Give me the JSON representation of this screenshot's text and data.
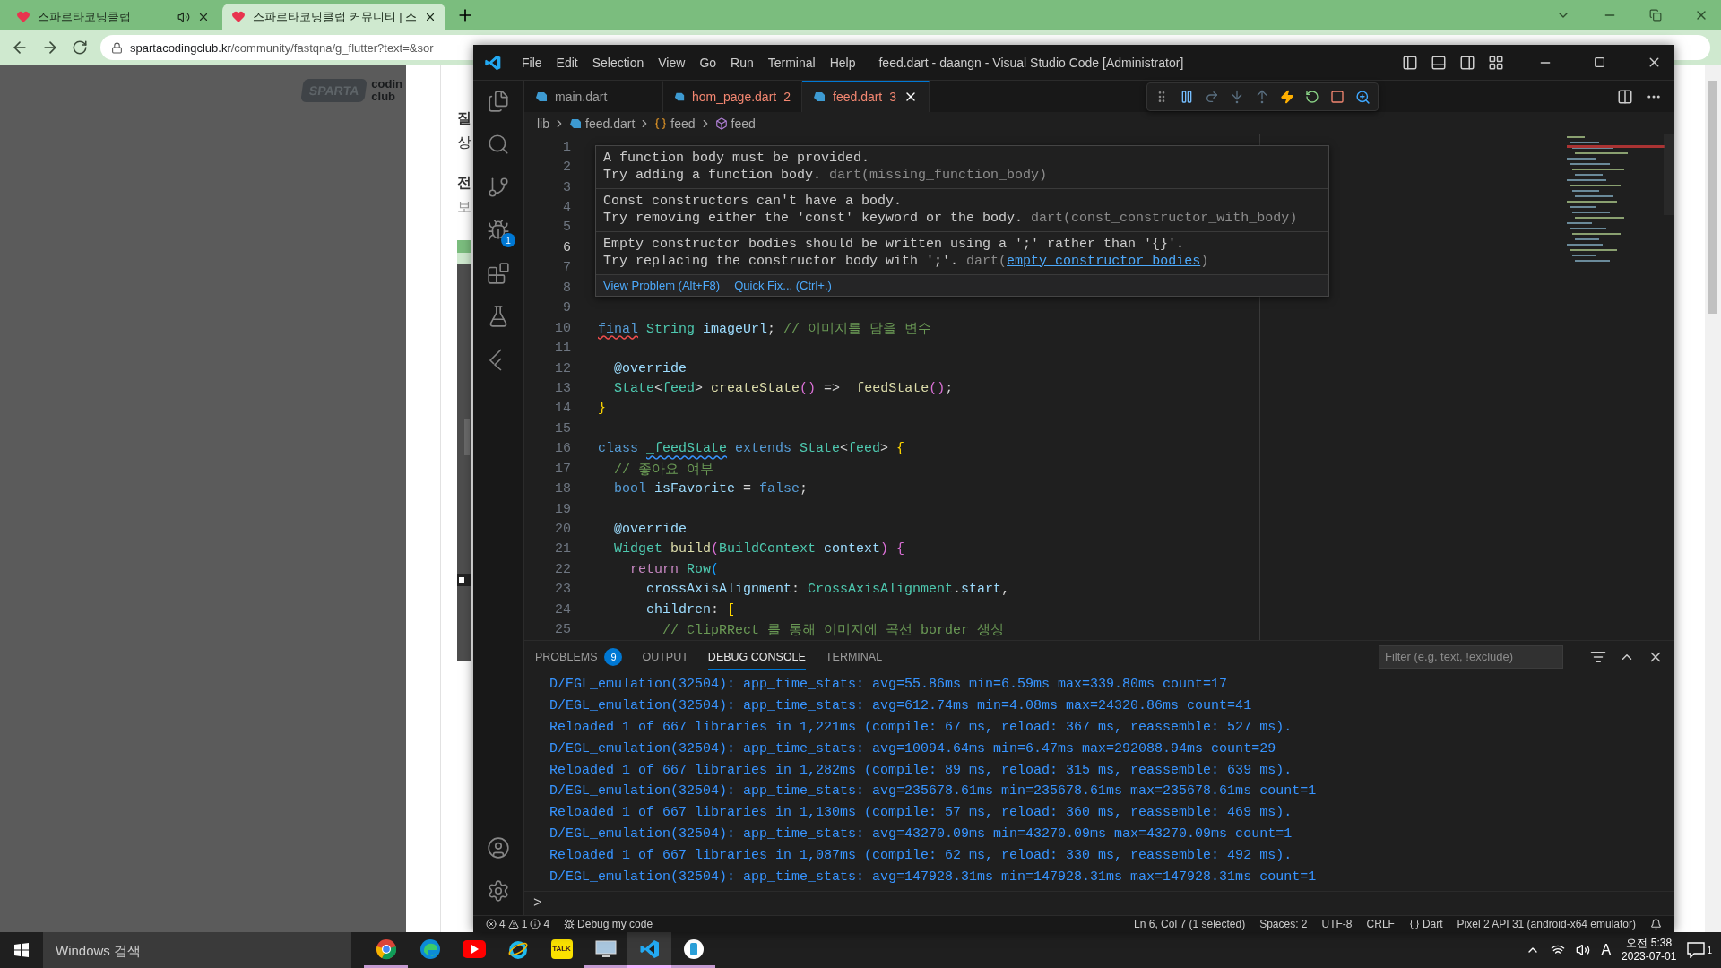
{
  "browser": {
    "tabs": [
      {
        "title": "스파르타코딩클럽",
        "selected": false,
        "audio": true
      },
      {
        "title": "스파르타코딩클럽 커뮤니티 | 스",
        "selected": true,
        "audio": false
      }
    ],
    "url": {
      "host": "spartacodingclub.kr",
      "path": "/community/fastqna/g_flutter?text=&sor"
    }
  },
  "page": {
    "logo": {
      "badge": "SPARTA",
      "words": [
        "codin",
        "club"
      ]
    },
    "texts": [
      {
        "kind": "heading",
        "text": "질"
      },
      {
        "kind": "body",
        "text": "상"
      },
      {
        "kind": "heading",
        "text": "전"
      },
      {
        "kind": "muted",
        "text": "보"
      }
    ]
  },
  "vscode": {
    "menu": [
      "File",
      "Edit",
      "Selection",
      "View",
      "Go",
      "Run",
      "Terminal",
      "Help"
    ],
    "title": "feed.dart - daangn - Visual Studio Code [Administrator]",
    "activity": [
      {
        "kind": "explorer",
        "selected": false
      },
      {
        "kind": "search",
        "selected": false
      },
      {
        "kind": "scm",
        "selected": false
      },
      {
        "kind": "debug",
        "selected": false,
        "badge": "1"
      },
      {
        "kind": "extensions",
        "selected": false
      },
      {
        "kind": "testing",
        "selected": false
      },
      {
        "kind": "flutter",
        "selected": false
      }
    ],
    "activity_bottom": [
      {
        "kind": "account"
      },
      {
        "kind": "settings"
      }
    ],
    "tabs": [
      {
        "label": "main.dart",
        "selected": false
      },
      {
        "label": "hom_page.dart",
        "selected": false,
        "problems": "2"
      },
      {
        "label": "feed.dart",
        "selected": true,
        "problems": "3"
      }
    ],
    "breadcrumbs": [
      {
        "kind": "folder",
        "label": "lib"
      },
      {
        "kind": "file",
        "label": "feed.dart"
      },
      {
        "kind": "class",
        "label": "feed"
      },
      {
        "kind": "member",
        "label": "feed"
      }
    ],
    "lines": [
      {
        "number": "1",
        "current": false
      },
      {
        "number": "2",
        "current": false
      },
      {
        "number": "3",
        "current": false
      },
      {
        "number": "4",
        "current": false
      },
      {
        "number": "5",
        "current": false
      },
      {
        "number": "6",
        "current": true
      },
      {
        "number": "7",
        "current": false
      },
      {
        "number": "8",
        "current": false
      },
      {
        "number": "9",
        "current": false
      },
      {
        "number": "10",
        "current": false,
        "tokens": [
          {
            "kind": "kw",
            "t": "final",
            "error_squiggle": true
          },
          {
            "kind": "type",
            "t": " String"
          },
          {
            "kind": "var",
            "t": " imageUrl"
          },
          {
            "kind": "plain",
            "t": ";"
          },
          {
            "kind": "comment",
            "t": " // 이미지를 담을 변수"
          }
        ]
      },
      {
        "number": "11",
        "current": false
      },
      {
        "number": "12",
        "current": false,
        "tokens": [
          {
            "kind": "anno",
            "t": "  @override"
          }
        ]
      },
      {
        "number": "13",
        "current": false,
        "tokens": [
          {
            "kind": "type",
            "t": "  State"
          },
          {
            "kind": "plain",
            "t": "<"
          },
          {
            "kind": "type",
            "t": "feed"
          },
          {
            "kind": "plain",
            "t": ">"
          },
          {
            "kind": "fn",
            "t": " createState"
          },
          {
            "kind": "b2",
            "t": "()"
          },
          {
            "kind": "plain",
            "t": " =>"
          },
          {
            "kind": "fn",
            "t": " _feedState"
          },
          {
            "kind": "b2",
            "t": "()"
          },
          {
            "kind": "plain",
            "t": ";"
          }
        ]
      },
      {
        "number": "14",
        "current": false,
        "tokens": [
          {
            "kind": "b1",
            "t": "}"
          }
        ]
      },
      {
        "number": "15",
        "current": false
      },
      {
        "number": "16",
        "current": false,
        "tokens": [
          {
            "kind": "kw",
            "t": "class "
          },
          {
            "kind": "type",
            "t": "_feedState",
            "info_squiggle": true
          },
          {
            "kind": "kw",
            "t": " extends"
          },
          {
            "kind": "type",
            "t": " State"
          },
          {
            "kind": "plain",
            "t": "<"
          },
          {
            "kind": "type",
            "t": "feed"
          },
          {
            "kind": "plain",
            "t": ">"
          },
          {
            "kind": "b1",
            "t": " {"
          }
        ]
      },
      {
        "number": "17",
        "current": false,
        "tokens": [
          {
            "kind": "comment",
            "t": "  // 좋아요 여부"
          }
        ]
      },
      {
        "number": "18",
        "current": false,
        "tokens": [
          {
            "kind": "kw",
            "t": "  bool"
          },
          {
            "kind": "var",
            "t": " isFavorite"
          },
          {
            "kind": "plain",
            "t": " ="
          },
          {
            "kind": "kw",
            "t": " false"
          },
          {
            "kind": "plain",
            "t": ";"
          }
        ]
      },
      {
        "number": "19",
        "current": false
      },
      {
        "number": "20",
        "current": false,
        "tokens": [
          {
            "kind": "anno",
            "t": "  @override"
          }
        ]
      },
      {
        "number": "21",
        "current": false,
        "tokens": [
          {
            "kind": "type",
            "t": "  Widget"
          },
          {
            "kind": "fn",
            "t": " build"
          },
          {
            "kind": "b2",
            "t": "("
          },
          {
            "kind": "type",
            "t": "BuildContext"
          },
          {
            "kind": "var",
            "t": " context"
          },
          {
            "kind": "b2",
            "t": ")"
          },
          {
            "kind": "b2",
            "t": " {"
          }
        ]
      },
      {
        "number": "22",
        "current": false,
        "tokens": [
          {
            "kind": "ctrl",
            "t": "    return"
          },
          {
            "kind": "type",
            "t": " Row"
          },
          {
            "kind": "b3",
            "t": "("
          }
        ]
      },
      {
        "number": "23",
        "current": false,
        "tokens": [
          {
            "kind": "var",
            "t": "      crossAxisAlignment"
          },
          {
            "kind": "plain",
            "t": ":"
          },
          {
            "kind": "type",
            "t": " CrossAxisAlignment"
          },
          {
            "kind": "plain",
            "t": "."
          },
          {
            "kind": "var",
            "t": "start"
          },
          {
            "kind": "plain",
            "t": ","
          }
        ]
      },
      {
        "number": "24",
        "current": false,
        "tokens": [
          {
            "kind": "var",
            "t": "      children"
          },
          {
            "kind": "plain",
            "t": ":"
          },
          {
            "kind": "b1",
            "t": " ["
          }
        ]
      },
      {
        "number": "25",
        "current": false,
        "tokens": [
          {
            "kind": "comment",
            "t": "        // ClipRRect 를 통해 이미지에 곡선 border 생성"
          }
        ]
      }
    ],
    "hover": {
      "problems": [
        {
          "message": "A function body must be provided.",
          "hint": "Try adding a function body.",
          "source": "dart(",
          "code": "missing_function_body",
          "end": ")",
          "link": false
        },
        {
          "message": "Const constructors can't have a body.",
          "hint": "Try removing either the 'const' keyword or the body.",
          "source": "dart(",
          "code": "const_constructor_with_body",
          "end": ")",
          "link": false
        },
        {
          "message": "Empty constructor bodies should be written using a ';' rather than '{}'.",
          "hint": "Try replacing the constructor body with ';'.",
          "source": "dart(",
          "code": "empty_constructor_bodies",
          "end": ")",
          "link": true
        }
      ],
      "actions": [
        "View Problem (Alt+F8)",
        "Quick Fix... (Ctrl+.)"
      ]
    },
    "panel": {
      "tabs": [
        {
          "label": "PROBLEMS",
          "selected": false,
          "badge": "9"
        },
        {
          "label": "OUTPUT",
          "selected": false
        },
        {
          "label": "DEBUG CONSOLE",
          "selected": true
        },
        {
          "label": "TERMINAL",
          "selected": false
        }
      ],
      "filter": {
        "placeholder": "Filter (e.g. text, !exclude)"
      },
      "console": [
        "D/EGL_emulation(32504): app_time_stats: avg=55.86ms min=6.59ms max=339.80ms count=17",
        "D/EGL_emulation(32504): app_time_stats: avg=612.74ms min=4.08ms max=24320.86ms count=41",
        "Reloaded 1 of 667 libraries in 1,221ms (compile: 67 ms, reload: 367 ms, reassemble: 527 ms).",
        "D/EGL_emulation(32504): app_time_stats: avg=10094.64ms min=6.47ms max=292088.94ms count=29",
        "Reloaded 1 of 667 libraries in 1,282ms (compile: 89 ms, reload: 315 ms, reassemble: 639 ms).",
        "D/EGL_emulation(32504): app_time_stats: avg=235678.61ms min=235678.61ms max=235678.61ms count=1",
        "Reloaded 1 of 667 libraries in 1,130ms (compile: 57 ms, reload: 360 ms, reassemble: 469 ms).",
        "D/EGL_emulation(32504): app_time_stats: avg=43270.09ms min=43270.09ms max=43270.09ms count=1",
        "Reloaded 1 of 667 libraries in 1,087ms (compile: 62 ms, reload: 330 ms, reassemble: 492 ms).",
        "D/EGL_emulation(32504): app_time_stats: avg=147928.31ms min=147928.31ms max=147928.31ms count=1"
      ],
      "prompt": ">"
    },
    "status": {
      "errors": "4",
      "warnings": "1",
      "infos": "4",
      "debug": "Debug my code",
      "items": [
        "Ln 6, Col 7 (1 selected)",
        "Spaces: 2",
        "UTF-8",
        "CRLF"
      ],
      "language": "Dart",
      "device": "Pixel 2 API 31 (android-x64 emulator)"
    }
  },
  "taskbar": {
    "search": {
      "placeholder": "Windows 검색"
    },
    "apps": [
      {
        "kind": "chrome",
        "running": true,
        "selected": false
      },
      {
        "kind": "edge",
        "running": false,
        "selected": false
      },
      {
        "kind": "youtube",
        "running": false,
        "selected": false
      },
      {
        "kind": "ie",
        "running": false,
        "selected": false
      },
      {
        "kind": "kakao",
        "label": "TALK",
        "running": false,
        "selected": false
      },
      {
        "kind": "monitor",
        "running": true,
        "selected": false
      },
      {
        "kind": "vscode",
        "running": true,
        "selected": true
      },
      {
        "kind": "app",
        "running": true,
        "selected": false
      }
    ],
    "ime": "A",
    "time": "오전 5:38",
    "date": "2023-07-01",
    "notifications": "1"
  }
}
